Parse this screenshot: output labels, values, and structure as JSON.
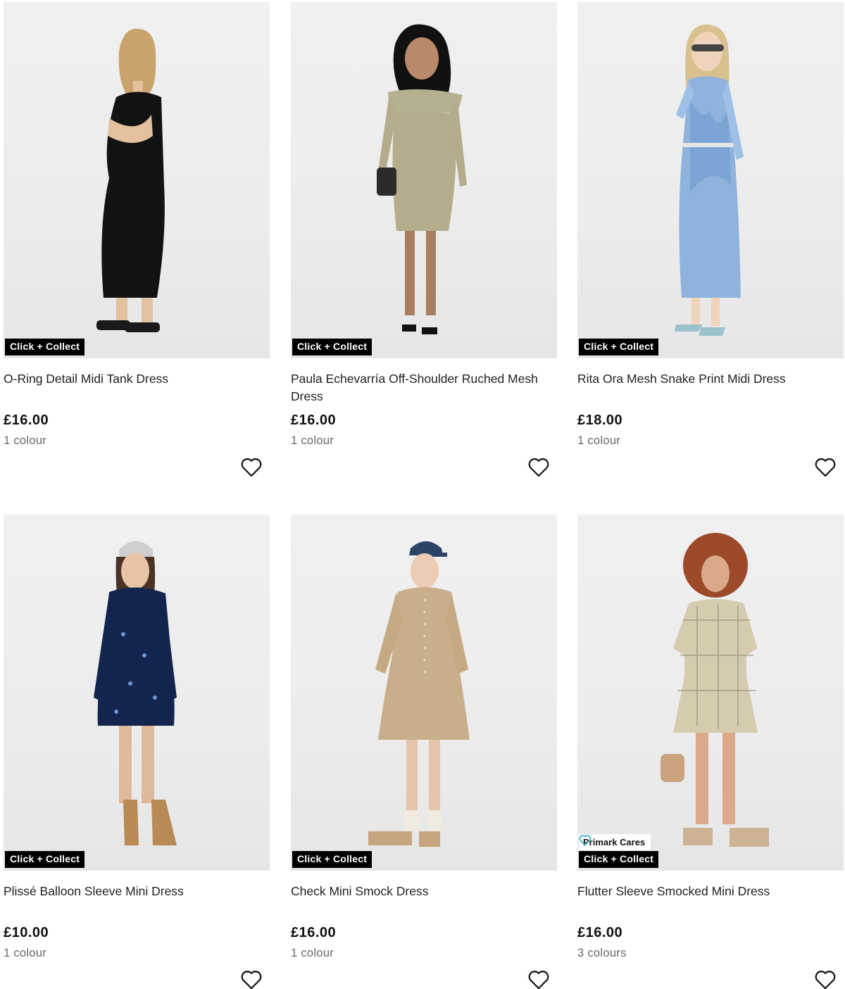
{
  "products": [
    {
      "badge": "Click + Collect",
      "title": "O-Ring Detail Midi Tank Dress",
      "price": "£16.00",
      "colours": "1 colour"
    },
    {
      "badge": "Click + Collect",
      "title": "Paula Echevarría Off-Shoulder Ruched Mesh Dress",
      "price": "£16.00",
      "colours": "1 colour"
    },
    {
      "badge": "Click + Collect",
      "title": "Rita Ora Mesh Snake Print Midi Dress",
      "price": "£18.00",
      "colours": "1 colour"
    },
    {
      "badge": "Click + Collect",
      "title": "Plissé Balloon Sleeve Mini Dress",
      "price": "£10.00",
      "colours": "1 colour"
    },
    {
      "badge": "Click + Collect",
      "title": "Check Mini Smock Dress",
      "price": "£16.00",
      "colours": "1 colour"
    },
    {
      "badge": "Click + Collect",
      "cares_badge": "Primark Cares",
      "title": "Flutter Sleeve Smocked Mini Dress",
      "price": "£16.00",
      "colours": "3 colours"
    }
  ],
  "icons": {
    "wishlist": "heart-outline-icon",
    "cares": "heart-icon"
  },
  "colors": {
    "badge_bg": "#000000",
    "badge_text": "#ffffff",
    "cares_accent": "#3fb1c6",
    "photo_bg": "#eeeeee"
  }
}
